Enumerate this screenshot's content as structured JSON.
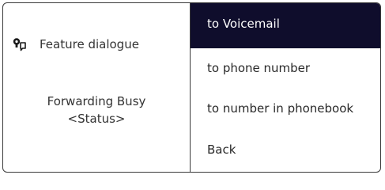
{
  "dialog": {
    "title": "Feature dialogue",
    "icon": "feature-dialog-icon",
    "status_line1": "Forwarding Busy",
    "status_line2": "<Status>"
  },
  "menu": {
    "items": [
      {
        "label": "to Voicemail",
        "selected": true
      },
      {
        "label": "to phone number",
        "selected": false
      },
      {
        "label": "to number in phonebook",
        "selected": false
      },
      {
        "label": "Back",
        "selected": false
      }
    ]
  },
  "colors": {
    "selected_background": "#0f0d2c",
    "selected_text": "#ffffff",
    "border": "#3a3a3a"
  }
}
